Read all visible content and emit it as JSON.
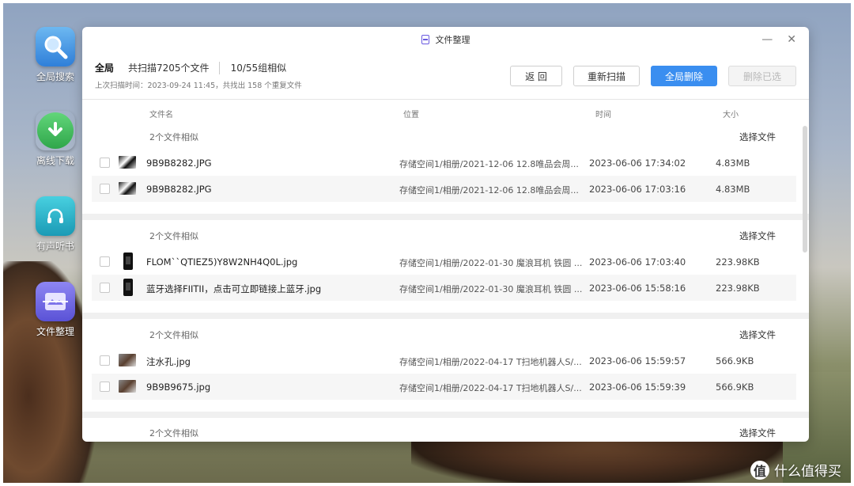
{
  "desktop": {
    "icons": [
      {
        "label": "全局搜索",
        "icon": "search-icon"
      },
      {
        "label": "离线下载",
        "icon": "download-icon"
      },
      {
        "label": "有声听书",
        "icon": "audiobook-icon"
      },
      {
        "label": "文件整理",
        "icon": "file-organize-icon"
      }
    ]
  },
  "window": {
    "title": "文件整理",
    "controls": {
      "minimize": "—",
      "close": "✕"
    }
  },
  "toolbar": {
    "scope": "全局",
    "scanned": "共扫描7205个文件",
    "groups": "10/55组相似",
    "last_scan": "上次扫描时间：2023-09-24 11:45，共找出 158 个重复文件",
    "back_label": "返 回",
    "rescan_label": "重新扫描",
    "delete_all_label": "全局删除",
    "delete_selected_label": "删除已选"
  },
  "columns": {
    "name": "文件名",
    "location": "位置",
    "time": "时间",
    "size": "大小"
  },
  "groups": [
    {
      "title": "2个文件相似",
      "select_label": "选择文件",
      "files": [
        {
          "name": "9B9B8282.JPG",
          "location": "存储空间1/相册/2021-12-06 12.8唯品会周...",
          "time": "2023-06-06 17:34:02",
          "size": "4.83MB"
        },
        {
          "name": "9B9B8282.JPG",
          "location": "存储空间1/相册/2021-12-06 12.8唯品会周...",
          "time": "2023-06-06 17:03:16",
          "size": "4.83MB"
        }
      ]
    },
    {
      "title": "2个文件相似",
      "select_label": "选择文件",
      "files": [
        {
          "name": "FLOM``QTIEZ5)Y8W2NH4Q0L.jpg",
          "location": "存储空间1/相册/2022-01-30 魔浪耳机 铁圆 ...",
          "time": "2023-06-06 17:03:40",
          "size": "223.98KB"
        },
        {
          "name": "蓝牙选择FIITII，点击可立即链接上蓝牙.jpg",
          "location": "存储空间1/相册/2022-01-30 魔浪耳机 铁圆 ...",
          "time": "2023-06-06 15:58:16",
          "size": "223.98KB"
        }
      ]
    },
    {
      "title": "2个文件相似",
      "select_label": "选择文件",
      "files": [
        {
          "name": "注水孔.jpg",
          "location": "存储空间1/相册/2022-04-17 T扫地机器人S/...",
          "time": "2023-06-06 15:59:57",
          "size": "566.9KB"
        },
        {
          "name": "9B9B9675.jpg",
          "location": "存储空间1/相册/2022-04-17 T扫地机器人S/...",
          "time": "2023-06-06 15:59:39",
          "size": "566.9KB"
        }
      ]
    },
    {
      "title": "2个文件相似",
      "select_label": "选择文件",
      "files": []
    }
  ],
  "watermark": {
    "logo": "值",
    "text": "什么值得买"
  }
}
